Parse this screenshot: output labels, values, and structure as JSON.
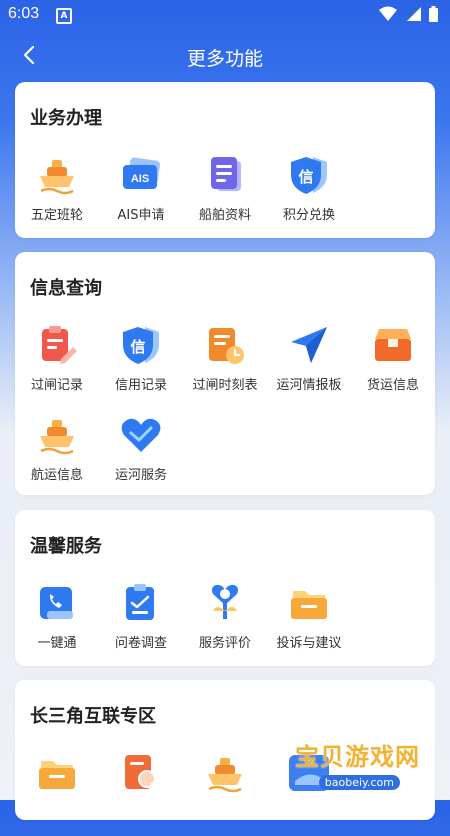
{
  "status": {
    "time": "6:03",
    "app_badge": "A"
  },
  "header": {
    "title": "更多功能"
  },
  "sections": [
    {
      "title": "业务办理",
      "items": [
        {
          "label": "五定班轮",
          "icon": "ship-icon"
        },
        {
          "label": "AIS申请",
          "icon": "ais-card-icon",
          "icon_text": "AIS"
        },
        {
          "label": "船舶资料",
          "icon": "document-icon"
        },
        {
          "label": "积分兑换",
          "icon": "credit-shield-icon",
          "icon_text": "信"
        }
      ]
    },
    {
      "title": "信息查询",
      "items": [
        {
          "label": "过闸记录",
          "icon": "clipboard-edit-icon"
        },
        {
          "label": "信用记录",
          "icon": "credit-shield-icon",
          "icon_text": "信"
        },
        {
          "label": "过闸时刻表",
          "icon": "schedule-clock-icon"
        },
        {
          "label": "运河情报板",
          "icon": "send-arrow-icon"
        },
        {
          "label": "货运信息",
          "icon": "cargo-box-icon"
        },
        {
          "label": "航运信息",
          "icon": "ship-icon"
        },
        {
          "label": "运河服务",
          "icon": "heart-handshake-icon"
        }
      ]
    },
    {
      "title": "温馨服务",
      "items": [
        {
          "label": "一键通",
          "icon": "phone-icon"
        },
        {
          "label": "问卷调查",
          "icon": "survey-icon"
        },
        {
          "label": "服务评价",
          "icon": "evaluation-icon"
        },
        {
          "label": "投诉与建议",
          "icon": "folder-icon"
        }
      ]
    },
    {
      "title": "长三角互联专区",
      "items": [
        {
          "label": "",
          "icon": "folder-icon"
        },
        {
          "label": "",
          "icon": "search-doc-icon"
        },
        {
          "label": "",
          "icon": "ship-icon"
        },
        {
          "label": "",
          "icon": "app-banner-icon"
        }
      ]
    }
  ],
  "watermark": {
    "text": "宝贝游戏网",
    "sub": "baobeiy.com"
  }
}
